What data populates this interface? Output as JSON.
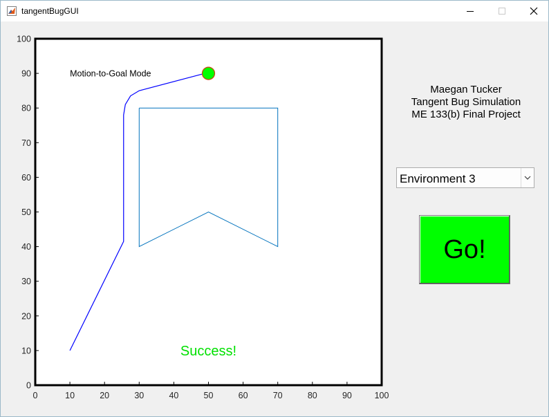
{
  "window": {
    "title": "tangentBugGUI",
    "controls": {
      "minimize_icon": "minimize-icon",
      "maximize_icon": "maximize-icon",
      "close_icon": "close-icon"
    }
  },
  "axes": {
    "xlim": [
      0,
      100
    ],
    "ylim": [
      0,
      100
    ],
    "xticks": [
      "0",
      "10",
      "20",
      "30",
      "40",
      "50",
      "60",
      "70",
      "80",
      "90",
      "100"
    ],
    "yticks": [
      "0",
      "10",
      "20",
      "30",
      "40",
      "50",
      "60",
      "70",
      "80",
      "90",
      "100"
    ],
    "mode_text": "Motion-to-Goal Mode",
    "status_text": "Success!",
    "status_color": "#00e000",
    "path_color": "#0000ff",
    "obstacle_color": "#0072bd",
    "goal_color": "#00ff00"
  },
  "chart_data": {
    "type": "line",
    "xlim": [
      0,
      100
    ],
    "ylim": [
      0,
      100
    ],
    "grid": false,
    "series": [
      {
        "role": "obstacle",
        "points": [
          [
            30,
            80
          ],
          [
            70,
            80
          ],
          [
            70,
            40
          ],
          [
            50,
            50
          ],
          [
            30,
            40
          ],
          [
            30,
            80
          ]
        ]
      },
      {
        "role": "robot-path",
        "points": [
          [
            10,
            10
          ],
          [
            25.5,
            41.5
          ],
          [
            25.5,
            78
          ],
          [
            26,
            81
          ],
          [
            27.5,
            83.5
          ],
          [
            30,
            85
          ],
          [
            49,
            90
          ]
        ]
      }
    ],
    "goal": {
      "x": 50,
      "y": 90
    },
    "annotations": [
      {
        "text": "Motion-to-Goal Mode",
        "x": 10,
        "y": 90
      },
      {
        "text": "Success!",
        "x": 50,
        "y": 10
      }
    ]
  },
  "credits": {
    "line1": "Maegan Tucker",
    "line2": "Tangent Bug Simulation",
    "line3": "ME 133(b) Final Project"
  },
  "environment_select": {
    "selected": "Environment 3",
    "arrow_icon": "chevron-down-icon"
  },
  "go_button": {
    "label": "Go!",
    "color": "#00ff00"
  }
}
